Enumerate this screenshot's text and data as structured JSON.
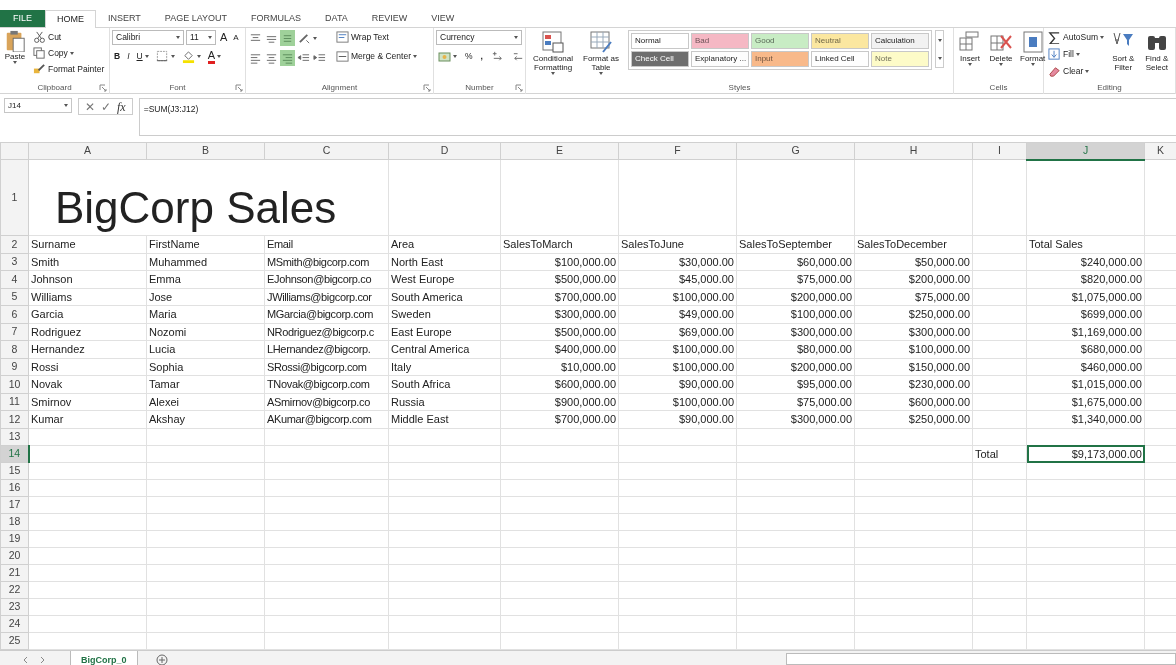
{
  "ribbon": {
    "tabs": [
      {
        "label": "FILE",
        "kind": "file",
        "selected": false
      },
      {
        "label": "HOME",
        "kind": "tab",
        "selected": true
      },
      {
        "label": "INSERT",
        "kind": "tab",
        "selected": false
      },
      {
        "label": "PAGE LAYOUT",
        "kind": "tab",
        "selected": false
      },
      {
        "label": "FORMULAS",
        "kind": "tab",
        "selected": false
      },
      {
        "label": "DATA",
        "kind": "tab",
        "selected": false
      },
      {
        "label": "REVIEW",
        "kind": "tab",
        "selected": false
      },
      {
        "label": "VIEW",
        "kind": "tab",
        "selected": false
      }
    ],
    "groups": [
      {
        "kind": "clipboard",
        "label": "Clipboard",
        "launcher": true,
        "paste": "Paste",
        "cut": "Cut",
        "copy": "Copy",
        "painter": "Format Painter"
      },
      {
        "kind": "font",
        "label": "Font",
        "launcher": true,
        "font": "Calibri",
        "size": "11",
        "grow": "A",
        "shrink": "A",
        "bold": "B",
        "italic": "I",
        "underline": "U",
        "font_color": "A"
      },
      {
        "kind": "alignment",
        "label": "Alignment",
        "launcher": true,
        "vertical": [
          {
            "selected": false
          },
          {
            "selected": false
          },
          {
            "selected": true
          }
        ],
        "horizontal": [
          {
            "selected": false
          },
          {
            "selected": false
          },
          {
            "selected": true
          }
        ],
        "wrap": "Wrap Text",
        "merge": "Merge & Center"
      },
      {
        "kind": "number",
        "label": "Number",
        "launcher": true,
        "format": "Currency",
        "percent": "%",
        "comma": ","
      },
      {
        "kind": "styles",
        "label": "Styles",
        "conditional": "Conditional Formatting",
        "table": "Format as Table",
        "gallery": [
          {
            "label": "Normal",
            "color": "#ffffff"
          },
          {
            "label": "Bad",
            "color": "#f5b8c4"
          },
          {
            "label": "Good",
            "color": "#c8ecc4"
          },
          {
            "label": "Neutral",
            "color": "#fbe7a0"
          },
          {
            "label": "Calculation",
            "color": "#f2f2f2"
          },
          {
            "label": "Check Cell",
            "color": "#6e6e6e"
          },
          {
            "label": "Explanatory ...",
            "color": "#fdfdfd"
          },
          {
            "label": "Input",
            "color": "#f8b98a"
          },
          {
            "label": "Linked Cell",
            "color": "#fefefe"
          },
          {
            "label": "Note",
            "color": "#fdfbc8"
          }
        ]
      },
      {
        "kind": "cells",
        "label": "Cells",
        "buttons": [
          "Insert",
          "Delete",
          "Format"
        ]
      },
      {
        "kind": "editing",
        "label": "Editing",
        "autosum": "AutoSum",
        "fill": "Fill",
        "clear": "Clear",
        "sort": "Sort & Filter",
        "find": "Find & Select"
      }
    ]
  },
  "formula_bar": {
    "name_box": "J14",
    "buttons": [
      "✕",
      "✓",
      "fx"
    ],
    "formula": "=SUM(J3:J12)"
  },
  "sheet": {
    "columns": [
      {
        "label": "A",
        "selected": false
      },
      {
        "label": "B",
        "selected": false
      },
      {
        "label": "C",
        "selected": false
      },
      {
        "label": "D",
        "selected": false
      },
      {
        "label": "E",
        "selected": false
      },
      {
        "label": "F",
        "selected": false
      },
      {
        "label": "G",
        "selected": false
      },
      {
        "label": "H",
        "selected": false
      },
      {
        "label": "I",
        "selected": false
      },
      {
        "label": "J",
        "selected": true
      },
      {
        "label": "K",
        "selected": false
      }
    ],
    "title_row": {
      "number": "1",
      "text": "BigCorp Sales"
    },
    "header_row": {
      "number": "2",
      "cells": [
        "Surname",
        "FirstName",
        "Email",
        "Area",
        "SalesToMarch",
        "SalesToJune",
        "SalesToSeptember",
        "SalesToDecember"
      ],
      "total": "Total Sales"
    },
    "data_rows": [
      {
        "number": "3",
        "cells": [
          "Smith",
          "Muhammed",
          "MSmith@bigcorp.com",
          "North East",
          "$100,000.00",
          "$30,000.00",
          "$60,000.00",
          "$50,000.00"
        ],
        "total": "$240,000.00"
      },
      {
        "number": "4",
        "cells": [
          "Johnson",
          "Emma",
          "EJohnson@bigcorp.co",
          "West Europe",
          "$500,000.00",
          "$45,000.00",
          "$75,000.00",
          "$200,000.00"
        ],
        "total": "$820,000.00"
      },
      {
        "number": "5",
        "cells": [
          "Williams",
          "Jose",
          "JWilliams@bigcorp.cor",
          "South America",
          "$700,000.00",
          "$100,000.00",
          "$200,000.00",
          "$75,000.00"
        ],
        "total": "$1,075,000.00"
      },
      {
        "number": "6",
        "cells": [
          "Garcia",
          "Maria",
          "MGarcia@bigcorp.com",
          "Sweden",
          "$300,000.00",
          "$49,000.00",
          "$100,000.00",
          "$250,000.00"
        ],
        "total": "$699,000.00"
      },
      {
        "number": "7",
        "cells": [
          "Rodriguez",
          "Nozomi",
          "NRodriguez@bigcorp.c",
          "East Europe",
          "$500,000.00",
          "$69,000.00",
          "$300,000.00",
          "$300,000.00"
        ],
        "total": "$1,169,000.00"
      },
      {
        "number": "8",
        "cells": [
          "Hernandez",
          "Lucia",
          "LHernandez@bigcorp.",
          "Central America",
          "$400,000.00",
          "$100,000.00",
          "$80,000.00",
          "$100,000.00"
        ],
        "total": "$680,000.00"
      },
      {
        "number": "9",
        "cells": [
          "Rossi",
          "Sophia",
          "SRossi@bigcorp.com",
          "Italy",
          "$10,000.00",
          "$100,000.00",
          "$200,000.00",
          "$150,000.00"
        ],
        "total": "$460,000.00"
      },
      {
        "number": "10",
        "cells": [
          "Novak",
          "Tamar",
          "TNovak@bigcorp.com",
          "South Africa",
          "$600,000.00",
          "$90,000.00",
          "$95,000.00",
          "$230,000.00"
        ],
        "total": "$1,015,000.00"
      },
      {
        "number": "11",
        "cells": [
          "Smirnov",
          "Alexei",
          "ASmirnov@bigcorp.co",
          "Russia",
          "$900,000.00",
          "$100,000.00",
          "$75,000.00",
          "$600,000.00"
        ],
        "total": "$1,675,000.00"
      },
      {
        "number": "12",
        "cells": [
          "Kumar",
          "Akshay",
          "AKumar@bigcorp.com",
          "Middle East",
          "$700,000.00",
          "$90,000.00",
          "$300,000.00",
          "$250,000.00"
        ],
        "total": "$1,340,000.00"
      }
    ],
    "blank_rows_above_total": [
      "13"
    ],
    "total_row": {
      "number": "14",
      "label": "Total",
      "value": "$9,173,000.00",
      "selected": true
    },
    "blank_rows_below_total": [
      "15",
      "16",
      "17",
      "18",
      "19",
      "20",
      "21",
      "22",
      "23",
      "24",
      "25"
    ]
  },
  "sheet_tabs": [
    {
      "label": "BigCorp_0",
      "selected": true
    }
  ]
}
